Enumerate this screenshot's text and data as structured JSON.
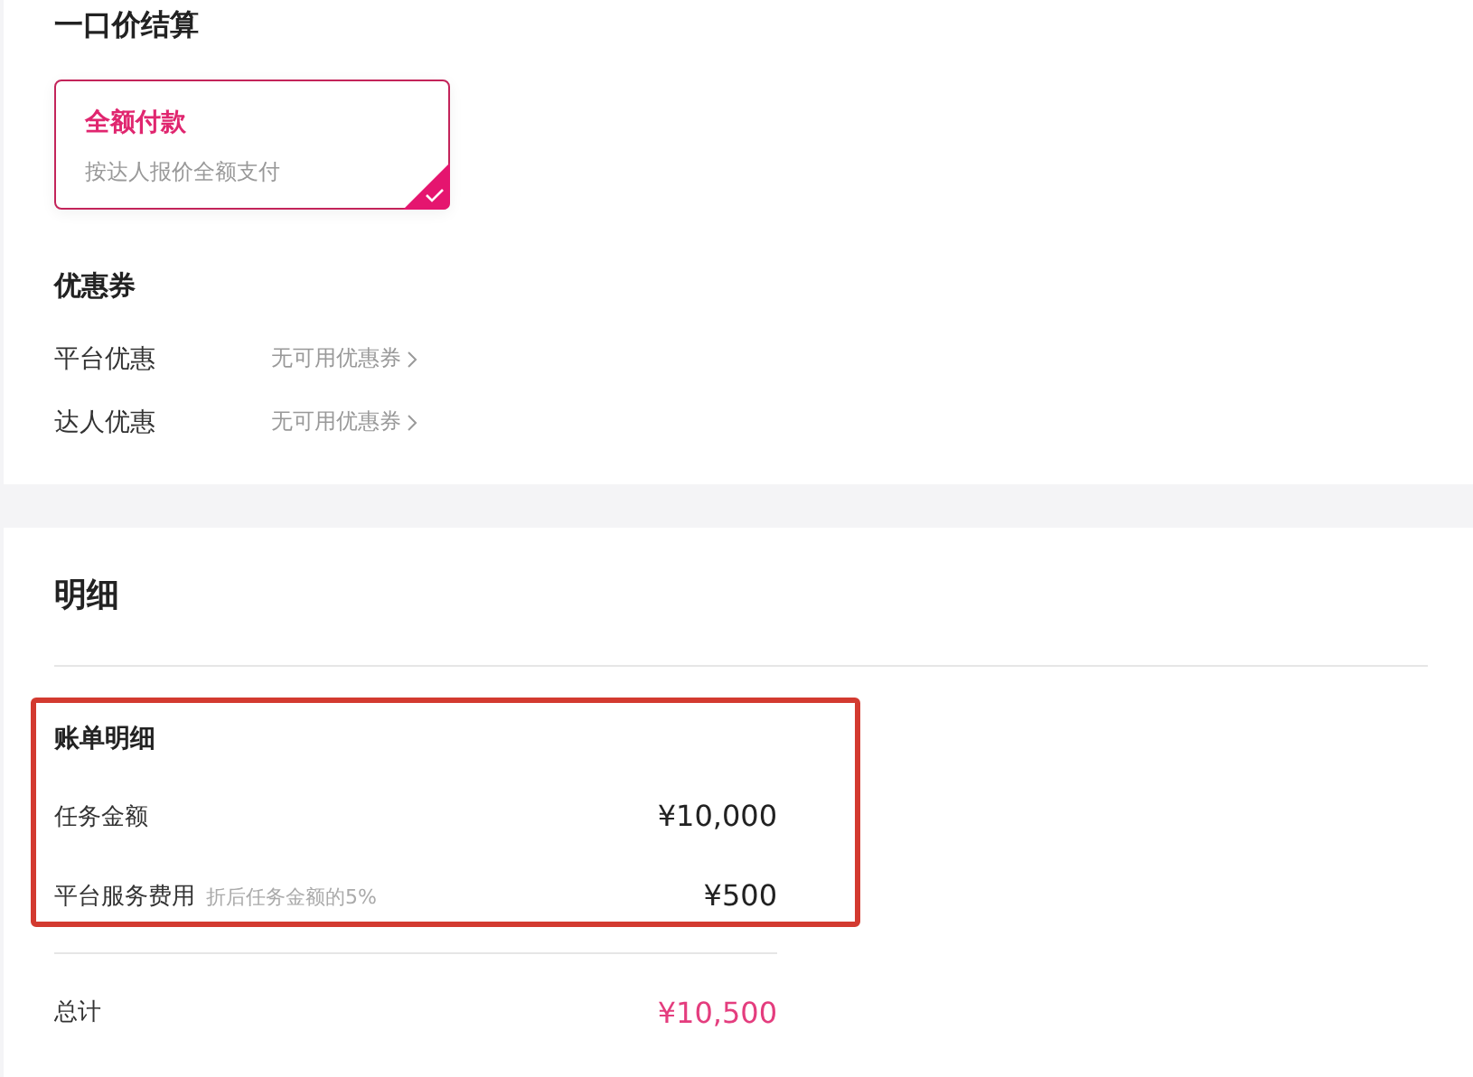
{
  "pricing": {
    "title": "一口价结算",
    "options": [
      {
        "title": "全额付款",
        "description": "按达人报价全额支付",
        "selected": true
      }
    ]
  },
  "coupons": {
    "title": "优惠券",
    "rows": [
      {
        "label": "平台优惠",
        "value": "无可用优惠券"
      },
      {
        "label": "达人优惠",
        "value": "无可用优惠券"
      }
    ]
  },
  "details": {
    "title": "明细",
    "bill": {
      "title": "账单明细",
      "rows": [
        {
          "label": "任务金额",
          "amount": "¥10,000"
        },
        {
          "label": "平台服务费用",
          "note": "折后任务金额的5%",
          "amount": "¥500"
        }
      ]
    },
    "total": {
      "label": "总计",
      "amount": "¥10,500"
    }
  }
}
